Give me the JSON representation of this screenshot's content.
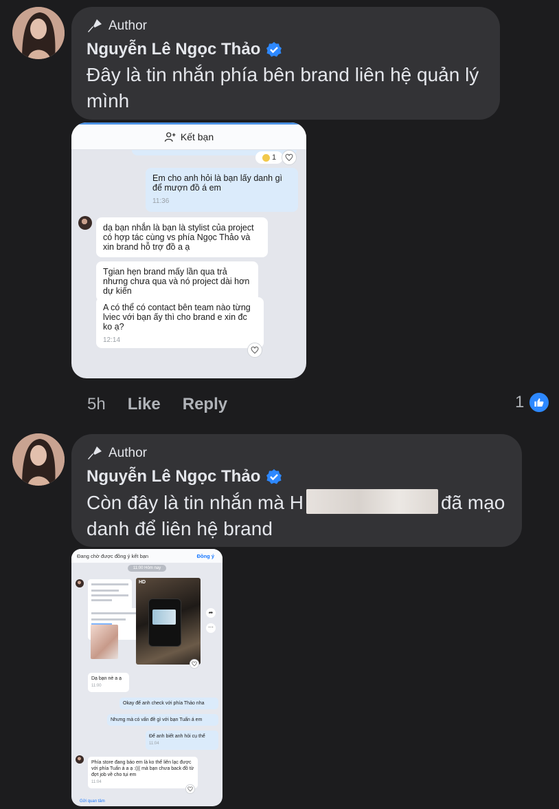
{
  "comments": [
    {
      "badge": "Author",
      "name": "Nguyễn Lê Ngọc Thảo",
      "text": "Đây là tin nhắn phía bên brand liên hệ quản lý mình",
      "time": "5h",
      "like_label": "Like",
      "reply_label": "Reply",
      "reaction_count": "1"
    },
    {
      "badge": "Author",
      "name": "Nguyễn Lê Ngọc Thảo",
      "text_before": "Còn đây là tin nhắn mà H",
      "text_after": "đã mạo danh để liên hệ brand"
    }
  ],
  "screenshot1": {
    "top_label": "Kết bạn",
    "reaction_count": "1",
    "messages": [
      {
        "text": "Em cho anh hỏi là bạn lấy danh gì để mượn đồ á em",
        "time": "11:36"
      },
      {
        "text": "dạ bạn nhắn là bạn là stylist của project có hợp tác cùng vs phía Ngọc Thảo và xin brand hỗ trợ đồ a ạ"
      },
      {
        "text": "Tgian hẹn brand mấy lần qua trả nhưng chưa qua và nó project dài hơn dự kiến"
      },
      {
        "text": "A có thể có contact bên team nào từng lviec với bạn ấy thì cho brand e xin đc ko ạ?",
        "time": "12:14"
      }
    ]
  },
  "screenshot2": {
    "top_label": "Đang chờ được đồng ý kết bạn",
    "accept_label": "Đồng ý",
    "day_label": "11:00 Hôm nay",
    "hd_label": "HD",
    "messages": [
      {
        "text": "Dạ bạn nè a ạ",
        "time": "11:00"
      },
      {
        "text": "Okay để anh check với phía Thảo nha"
      },
      {
        "text": "Nhưng mà có vấn đề gì với bạn Tuấn á em"
      },
      {
        "text": "Để anh biết anh hỏi cụ thể",
        "time": "11:04"
      },
      {
        "text": "Phía store đang báo em là ko thể liên lạc được với phía Tuấn á a ạ :((( mà bạn chưa back đồ từ đợt job về cho tụi em",
        "time": "11:04"
      }
    ],
    "bottom_label": "Gửi quan tâm"
  },
  "colors": {
    "bubble": "#333336",
    "background": "#1c1c1e",
    "accent": "#2d88ff",
    "verified": "#2d88ff"
  }
}
